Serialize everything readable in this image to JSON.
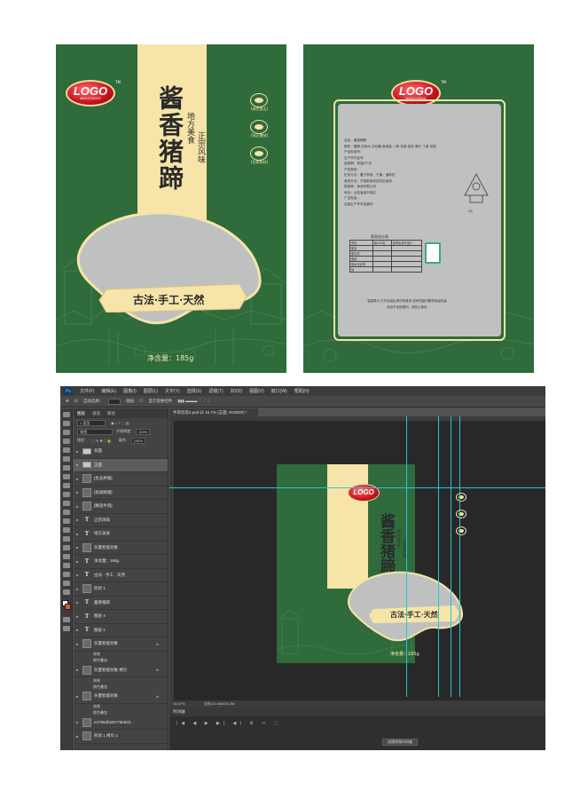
{
  "front_package": {
    "logo_text": "LOGO",
    "logo_sub": "MINGCHENG",
    "logo_tm": "TM",
    "title": "酱香猪蹄",
    "sub_a": "地方美食",
    "sub_b": "正宗风味",
    "ribbon_text": "古法·手工·天然",
    "net_content": "净含量：185g",
    "badges": [
      "[绿色食品]",
      "[纯正美味]",
      "[优质原料]"
    ]
  },
  "back_package": {
    "logo_text": "LOGO",
    "logo_sub": "MINGCHENG",
    "logo_tm": "TM",
    "info_lines": [
      "品名：酱香猪蹄",
      "配料：猪蹄  饮用水  白砂糖  食用盐  八角  花椒  桂皮  香叶  丁香  花椒",
      "产品标准号：",
      "生产许可证号：",
      "保质期：常温6个月",
      "产品类型：",
      "贮存方法：置于阴凉、干燥、通风处",
      "食用方法：开袋即食或加热后食用",
      "制造商：食品有限公司",
      "地址：山西省省市某区",
      "广告电话：",
      "包装生产许可证编号："
    ],
    "nutrition_title": "营养成分表",
    "nutrition_rows": [
      [
        "项目",
        "每100克",
        "营养素参考值%"
      ],
      [
        "能量",
        "",
        ""
      ],
      [
        "蛋白质",
        "",
        ""
      ],
      [
        "脂肪",
        "",
        ""
      ],
      [
        "碳水化合物",
        "",
        ""
      ],
      [
        "钠",
        "",
        ""
      ]
    ],
    "footer_1": "温馨提示  打开包装后请尽快食用  如有质量问题请保留包装",
    "footer_2": "本品不含防腐剂，请放心食用",
    "stamp_text": "QS"
  },
  "photoshop": {
    "menu": [
      "文件(F)",
      "编辑(E)",
      "图像(I)",
      "图层(L)",
      "文字(Y)",
      "选择(S)",
      "滤镜(T)",
      "3D(D)",
      "视图(V)",
      "窗口(W)",
      "帮助(H)"
    ],
    "options": [
      "自动选择：",
      "图层",
      "显示变换控件"
    ],
    "panel_tabs": [
      "图层",
      "通道",
      "路径"
    ],
    "filter_label": "类型",
    "blend_mode": "穿透",
    "opacity_label": "不透明度：",
    "opacity_value": "100%",
    "lock_label": "锁定：",
    "fill_label": "填充：",
    "fill_value": "100%",
    "doc_tab": "牛肉包装2.psd @ 16.7% (正面, RGB/8#) *",
    "status_zoom": "16.67%",
    "status_doc": "文档:22.4M/419.2M",
    "timeline_tab": "时间轴",
    "timeline_controls": "|◀  ◀  ▶  ▶|  ◀)  ⚙  ✂  ⬚",
    "timeline_button": "创建视频时间轴",
    "layers": [
      {
        "name": "背面",
        "kind": "folder",
        "eye": "●"
      },
      {
        "name": "正面",
        "kind": "folder",
        "eye": "●"
      },
      {
        "name": "[生态养殖]",
        "kind": "image",
        "eye": "●"
      },
      {
        "name": "[优质鲜猪]",
        "kind": "image",
        "eye": "●"
      },
      {
        "name": "[精选牛肉]",
        "kind": "image",
        "eye": "●"
      },
      {
        "name": "正宗风味",
        "kind": "text",
        "eye": "●"
      },
      {
        "name": "地方美食",
        "kind": "text",
        "eye": "●"
      },
      {
        "name": "矢量智能对象",
        "kind": "image",
        "eye": "●"
      },
      {
        "name": "净含量：185g",
        "kind": "text",
        "eye": "●"
      },
      {
        "name": "古法 · 手工 · 天然",
        "kind": "text",
        "eye": "●"
      },
      {
        "name": "形状 1",
        "kind": "image",
        "eye": "●"
      },
      {
        "name": "酱香猪蹄",
        "kind": "text",
        "eye": "●"
      },
      {
        "name": "图层 4",
        "kind": "text",
        "eye": "●"
      },
      {
        "name": "图层 2",
        "kind": "text",
        "eye": "●"
      },
      {
        "name": "矢量智能对象",
        "kind": "image",
        "eye": "●",
        "fx": "fx"
      },
      {
        "name": "效果",
        "kind": "sub"
      },
      {
        "name": "颜色叠加",
        "kind": "sub"
      },
      {
        "name": "矢量智能对象 拷贝",
        "kind": "image",
        "eye": "●",
        "fx": "fx"
      },
      {
        "name": "效果",
        "kind": "sub"
      },
      {
        "name": "颜色叠加",
        "kind": "sub"
      },
      {
        "name": "矢量智能对象",
        "kind": "image",
        "eye": "●",
        "fx": "fx"
      },
      {
        "name": "效果",
        "kind": "sub"
      },
      {
        "name": "颜色叠加",
        "kind": "sub"
      },
      {
        "name": "e4795df326775b833...",
        "kind": "image",
        "eye": "●"
      },
      {
        "name": "形状 1 拷贝 2",
        "kind": "image",
        "eye": "●"
      }
    ],
    "canvas_package": {
      "logo_text": "LOGO",
      "title": "酱香猪蹄",
      "sub_a": "地方美食",
      "sub_b": "正宗风味",
      "ribbon_text": "古法·手工·天然",
      "net_content": "净含量：185g"
    }
  },
  "colors": {
    "package_green": "#2f6b3b",
    "cream": "#f6e4a8",
    "logo_red": "#c4141f",
    "placeholder_grey": "#bfc1c1",
    "guide_cyan": "#29c4d6",
    "ps_dark": "#282828"
  }
}
